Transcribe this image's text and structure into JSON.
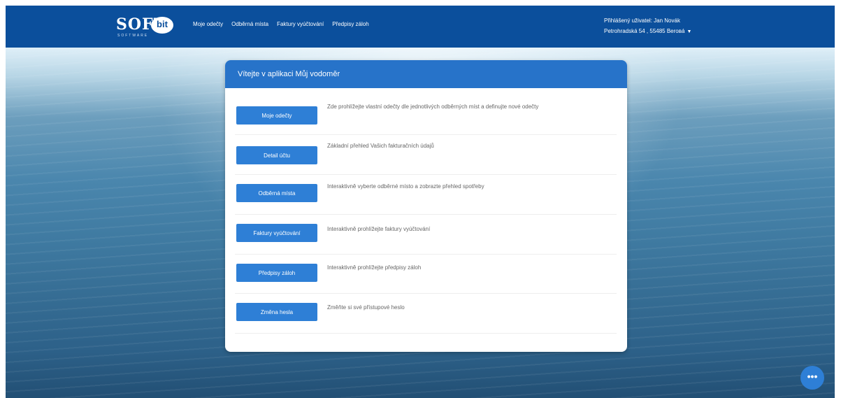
{
  "brand": {
    "logo_main": "SOFT",
    "logo_badge": "bit",
    "logo_sub": "SOFTWARE"
  },
  "nav": {
    "items": [
      "Moje odečty",
      "Odběrná místa",
      "Faktury vyúčtování",
      "Předpisy záloh"
    ]
  },
  "user": {
    "line1": "Přihlášený uživatel: Jan Novák",
    "line2": "Petrohradská 54 , 55485 Beroвá",
    "caret": "▼"
  },
  "card": {
    "title": "Vítejte v aplikaci Můj vodoměr",
    "rows": [
      {
        "button": "Moje odečty",
        "desc": "Zde prohlížejte vlastní odečty dle jednotlivých odběrných míst a definujte nové odečty"
      },
      {
        "button": "Detail účtu",
        "desc": "Základní přehled Vašich fakturačních údajů"
      },
      {
        "button": "Odběrná místa",
        "desc": "Interaktivně vyberte odběrné místo a zobrazte přehled spotřeby"
      },
      {
        "button": "Faktury vyúčtování",
        "desc": "Interaktivně prohlížejte faktury vyúčtování"
      },
      {
        "button": "Předpisy záloh",
        "desc": "Interaktivně prohlížejte předpisy záloh"
      },
      {
        "button": "Změna hesla",
        "desc": "Změňte si své přístupové heslo"
      }
    ]
  },
  "chat": {
    "label": "•••"
  },
  "colors": {
    "nav": "#0b4f9c",
    "card_header": "#2773c9",
    "button": "#2e7fd6"
  }
}
